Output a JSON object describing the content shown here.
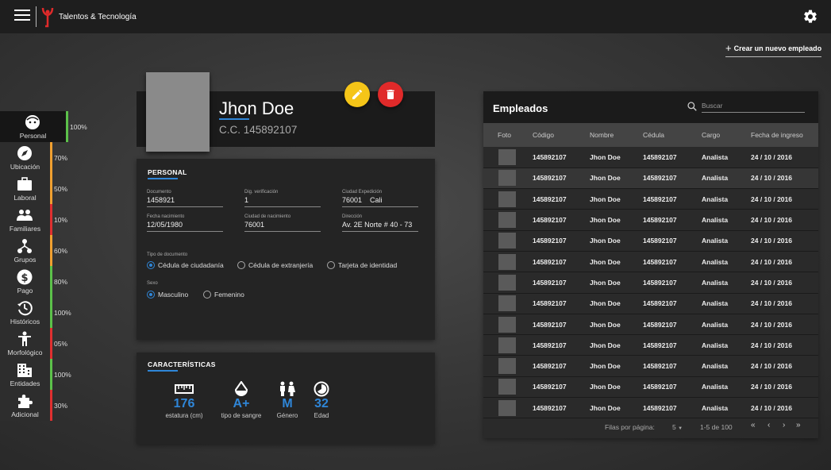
{
  "header": {
    "brand": "Talentos & Tecnología",
    "icons": [
      "menu-icon",
      "logo-icon",
      "gear-icon"
    ]
  },
  "create_button": {
    "plus": "+",
    "label": "Crear un nuevo empleado"
  },
  "sidenav": {
    "items": [
      {
        "label": "Personal",
        "pct": "100%",
        "icon": "face-icon",
        "color": "#5cc14a",
        "active": true
      },
      {
        "label": "Ubicación",
        "pct": "70%",
        "icon": "compass-icon",
        "color": "#f0a030"
      },
      {
        "label": "Laboral",
        "pct": "50%",
        "icon": "briefcase-icon",
        "color": "#f0a030"
      },
      {
        "label": "Familiares",
        "pct": "10%",
        "icon": "people-icon",
        "color": "#e03030"
      },
      {
        "label": "Grupos",
        "pct": "60%",
        "icon": "hierarchy-icon",
        "color": "#f0a030"
      },
      {
        "label": "Pago",
        "pct": "80%",
        "icon": "dollar-icon",
        "color": "#5cc14a"
      },
      {
        "label": "Históricos",
        "pct": "100%",
        "icon": "history-icon",
        "color": "#5cc14a"
      },
      {
        "label": "Morfológico",
        "pct": "05%",
        "icon": "person-icon",
        "color": "#e03030"
      },
      {
        "label": "Entidades",
        "pct": "100%",
        "icon": "building-icon",
        "color": "#5cc14a"
      },
      {
        "label": "Adicional",
        "pct": "30%",
        "icon": "puzzle-icon",
        "color": "#e03030"
      }
    ]
  },
  "profile": {
    "name": "Jhon Doe",
    "id": "C.C. 145892107"
  },
  "personal": {
    "title": "PERSONAL",
    "documento": {
      "label": "Documento",
      "value": "1458921"
    },
    "verificacion": {
      "label": "Dig. verificación",
      "value": "1"
    },
    "ciudad_exp": {
      "label": "Ciudad Expedición",
      "code": "76001",
      "city": "Cali"
    },
    "fecha_nac": {
      "label": "Fecha nacimiento",
      "value": "12/05/1980"
    },
    "ciudad_nac": {
      "label": "Ciudad de nacimiento",
      "value": "76001"
    },
    "direccion": {
      "label": "Dirección",
      "value": "Av. 2E Norte # 40 - 73"
    },
    "tipo_doc": {
      "label": "Tipo de documento",
      "options": [
        "Cédula de ciudadanía",
        "Cédula de extranjería",
        "Tarjeta de identidad"
      ],
      "selected": "Cédula de ciudadanía"
    },
    "sexo": {
      "label": "Sexo",
      "options": [
        "Masculino",
        "Femenino"
      ],
      "selected": "Masculino"
    }
  },
  "caracteristicas": {
    "title": "CARACTERÍSTICAS",
    "stats": [
      {
        "value": "176",
        "caption": "estatura (cm)",
        "icon": "ruler-icon"
      },
      {
        "value": "A+",
        "caption": "tipo de sangre",
        "icon": "blood-drop-icon"
      },
      {
        "value": "M",
        "caption": "Género",
        "icon": "gender-icon"
      },
      {
        "value": "32",
        "caption": "Edad",
        "icon": "age-icon"
      }
    ]
  },
  "employees": {
    "title": "Empleados",
    "search_placeholder": "Buscar",
    "columns": [
      "Foto",
      "Código",
      "Nombre",
      "Cédula",
      "Cargo",
      "Fecha de ingreso"
    ],
    "rows": [
      [
        "145892107",
        "Jhon Doe",
        "145892107",
        "Analista",
        "24 / 10 / 2016"
      ],
      [
        "145892107",
        "Jhon Doe",
        "145892107",
        "Analista",
        "24 / 10 / 2016"
      ],
      [
        "145892107",
        "Jhon Doe",
        "145892107",
        "Analista",
        "24 / 10 / 2016"
      ],
      [
        "145892107",
        "Jhon Doe",
        "145892107",
        "Analista",
        "24 / 10 / 2016"
      ],
      [
        "145892107",
        "Jhon Doe",
        "145892107",
        "Analista",
        "24 / 10 / 2016"
      ],
      [
        "145892107",
        "Jhon Doe",
        "145892107",
        "Analista",
        "24 / 10 / 2016"
      ],
      [
        "145892107",
        "Jhon Doe",
        "145892107",
        "Analista",
        "24 / 10 / 2016"
      ],
      [
        "145892107",
        "Jhon Doe",
        "145892107",
        "Analista",
        "24 / 10 / 2016"
      ],
      [
        "145892107",
        "Jhon Doe",
        "145892107",
        "Analista",
        "24 / 10 / 2016"
      ],
      [
        "145892107",
        "Jhon Doe",
        "145892107",
        "Analista",
        "24 / 10 / 2016"
      ],
      [
        "145892107",
        "Jhon Doe",
        "145892107",
        "Analista",
        "24 / 10 / 2016"
      ],
      [
        "145892107",
        "Jhon Doe",
        "145892107",
        "Analista",
        "24 / 10 / 2016"
      ],
      [
        "145892107",
        "Jhon Doe",
        "145892107",
        "Analista",
        "24 / 10 / 2016"
      ]
    ],
    "highlighted_row": 1,
    "footer": {
      "rows_per_page_label": "Filas por página:",
      "rows_per_page_value": "5",
      "range": "1-5 de 100",
      "first": "«",
      "prev": "‹",
      "next": "›",
      "last": "»"
    }
  },
  "colors": {
    "accent": "#2f86d8",
    "edit": "#f5c518",
    "delete": "#e02a2a"
  }
}
